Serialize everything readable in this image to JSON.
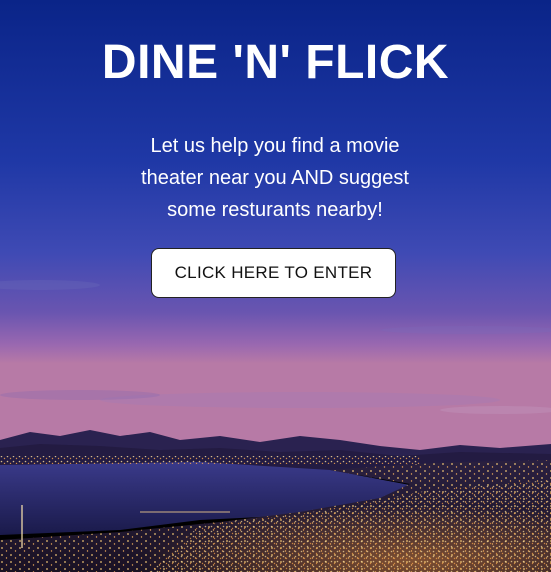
{
  "header": {
    "title": "DINE 'N' FLICK"
  },
  "hero": {
    "tagline": "Let us help you find a movie theater near you AND suggest some resturants nearby!",
    "enter_button_label": "CLICK HERE TO ENTER"
  },
  "colors": {
    "sky_top": "#0a2a8a",
    "sky_mid": "#2d3fa8",
    "dusk_purple": "#8a5aa8",
    "water": "#2a2a6a",
    "text": "#ffffff",
    "button_bg": "#ffffff",
    "button_text": "#111111"
  }
}
